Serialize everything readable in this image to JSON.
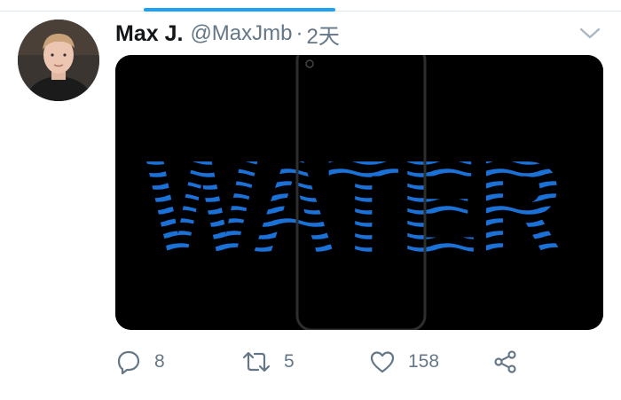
{
  "tweet": {
    "author_name": "Max J.",
    "handle": "@MaxJmb",
    "separator": "·",
    "time": "2天",
    "media": {
      "text": "WATER",
      "accent_color": "#1a72d8",
      "background": "#000000"
    }
  },
  "actions": {
    "reply_count": "8",
    "retweet_count": "5",
    "like_count": "158"
  },
  "colors": {
    "brand": "#1da1f2",
    "muted": "#657786",
    "text": "#14171a"
  },
  "icons": [
    "chevron-down-icon",
    "reply-icon",
    "retweet-icon",
    "like-icon",
    "share-icon"
  ]
}
